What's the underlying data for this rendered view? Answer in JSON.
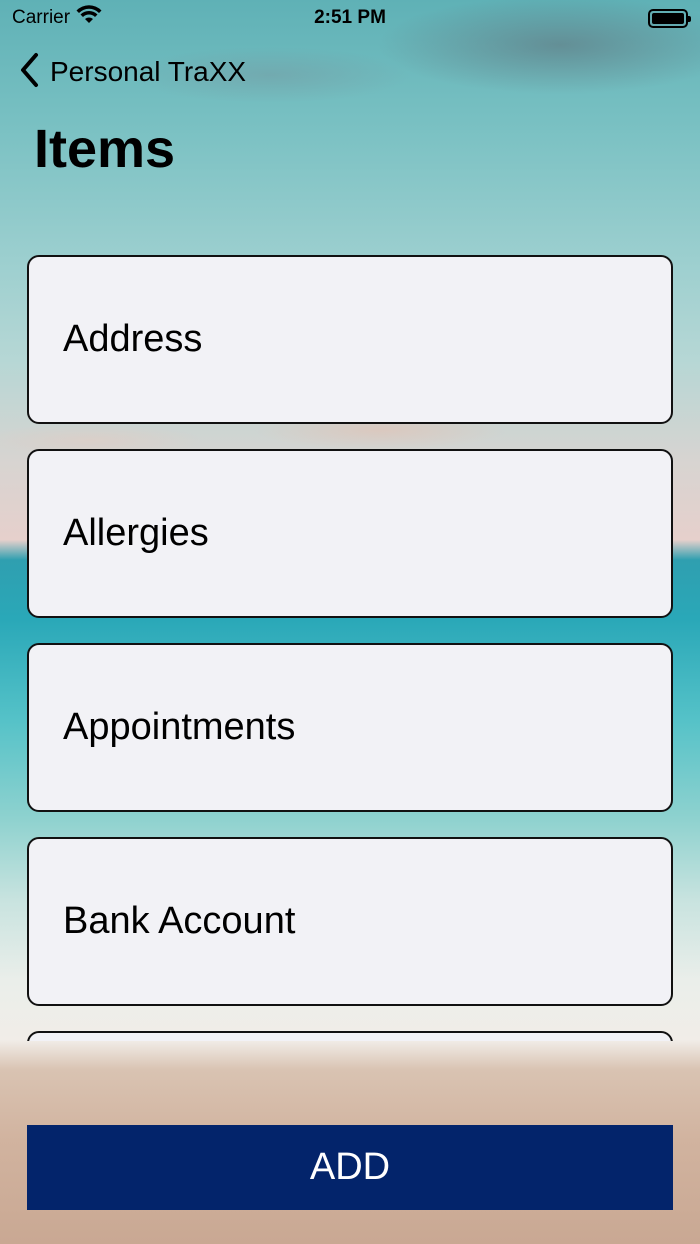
{
  "status_bar": {
    "carrier": "Carrier",
    "time": "2:51 PM"
  },
  "nav": {
    "back_label": "Personal TraXX"
  },
  "page": {
    "title": "Items"
  },
  "items": [
    {
      "label": "Address"
    },
    {
      "label": "Allergies"
    },
    {
      "label": "Appointments"
    },
    {
      "label": "Bank Account"
    },
    {
      "label": ""
    }
  ],
  "add_button": {
    "label": "ADD",
    "color": "#03246b"
  },
  "icons": [
    "wifi-icon",
    "battery-icon",
    "chevron-left-icon"
  ]
}
